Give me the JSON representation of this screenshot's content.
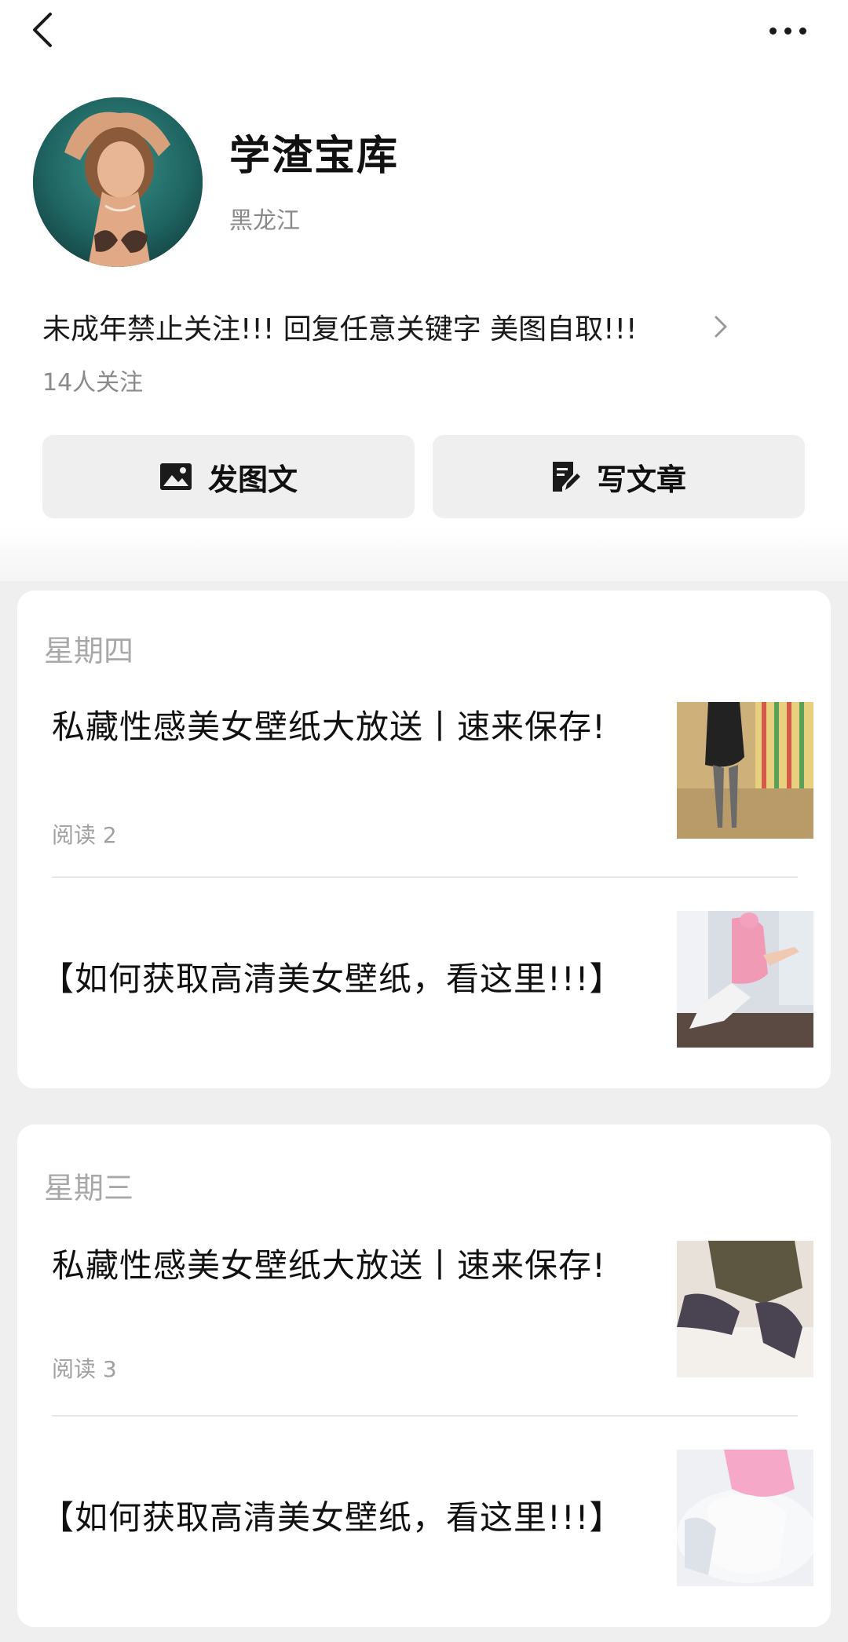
{
  "nav": {
    "back_icon": "back-chevron-icon",
    "more_icon": "more-dots-icon"
  },
  "profile": {
    "name": "学渣宝库",
    "region": "黑龙江",
    "description": "未成年禁止关注!!!  回复任意关键字 美图自取!!!",
    "followers": "14人关注"
  },
  "actions": {
    "post_photo_label": "发图文",
    "post_photo_icon": "image-icon",
    "write_article_label": "写文章",
    "write_article_icon": "write-note-icon"
  },
  "feed": [
    {
      "day": "星期四",
      "articles": [
        {
          "title": "私藏性感美女壁纸大放送丨速来保存!",
          "meta": "阅读 2"
        },
        {
          "title": "【如何获取高清美女壁纸，看这里!!!】",
          "meta": ""
        }
      ]
    },
    {
      "day": "星期三",
      "articles": [
        {
          "title": "私藏性感美女壁纸大放送丨速来保存!",
          "meta": "阅读 3"
        },
        {
          "title": "【如何获取高清美女壁纸，看这里!!!】",
          "meta": ""
        }
      ]
    }
  ],
  "colors": {
    "background": "#ffffff",
    "feed_background": "#efefef",
    "button_background": "#efefef",
    "secondary_text": "#8a8a8a",
    "day_text": "#a8a8a8"
  }
}
